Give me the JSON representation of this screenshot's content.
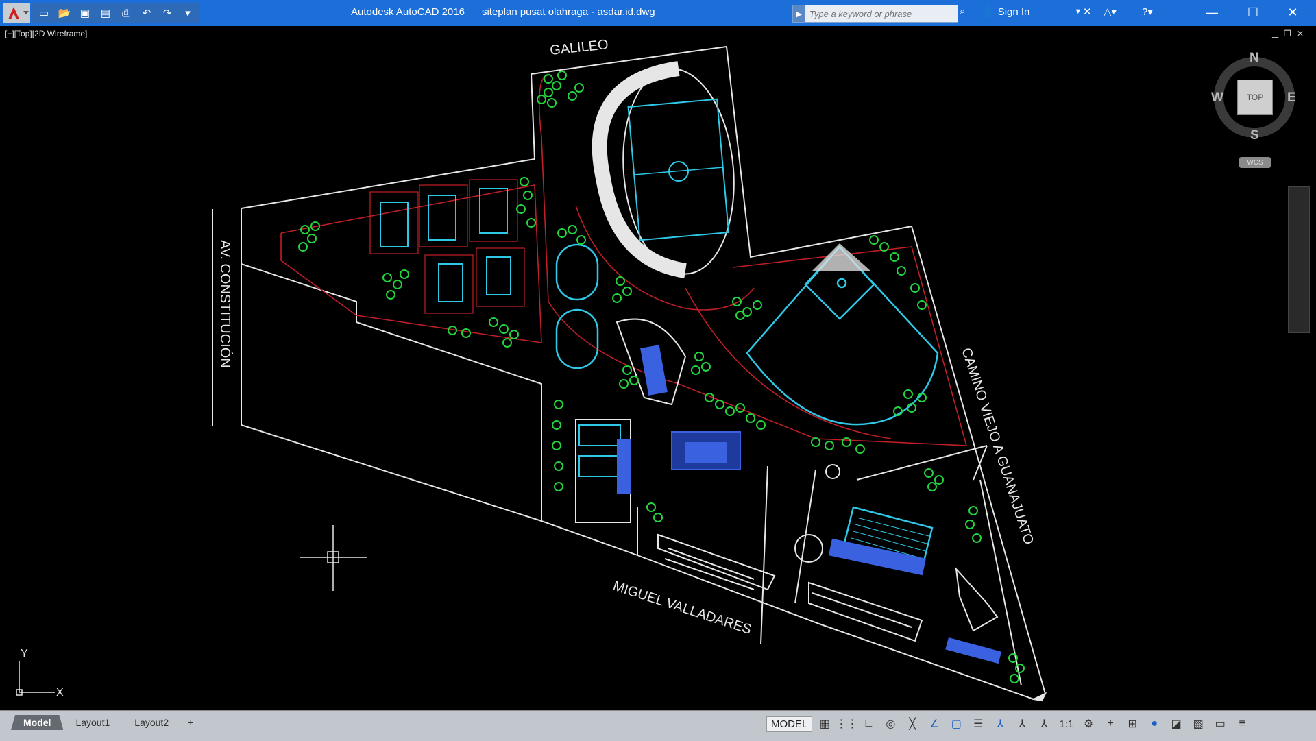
{
  "titlebar": {
    "app": "Autodesk AutoCAD 2016",
    "file": "siteplan pusat olahraga - asdar.id.dwg",
    "search_placeholder": "Type a keyword or phrase",
    "sign_in": "Sign In"
  },
  "viewport": {
    "label": "[−][Top][2D Wireframe]",
    "ucs_x": "X",
    "ucs_y": "Y"
  },
  "drawing": {
    "street_north": "GALILEO",
    "street_west": "AV. CONSTITUCIÓN",
    "street_south": "MIGUEL VALLADARES",
    "street_east": "CAMINO VIEJO A GUANAJUATO"
  },
  "viewcube": {
    "north": "N",
    "south": "S",
    "east": "E",
    "west": "W",
    "face": "TOP",
    "wcs": "WCS"
  },
  "statusbar": {
    "tabs": [
      "Model",
      "Layout1",
      "Layout2",
      "+"
    ],
    "model_button": "MODEL",
    "annotation_scale": "1:1"
  },
  "colors": {
    "titlebar": "#1c6fd8",
    "site_boundary": "#e6e6e6",
    "paths": "#c01f28",
    "trees": "#23d43c",
    "fields": "#2fc8e6",
    "buildings": "#3a62e0"
  }
}
